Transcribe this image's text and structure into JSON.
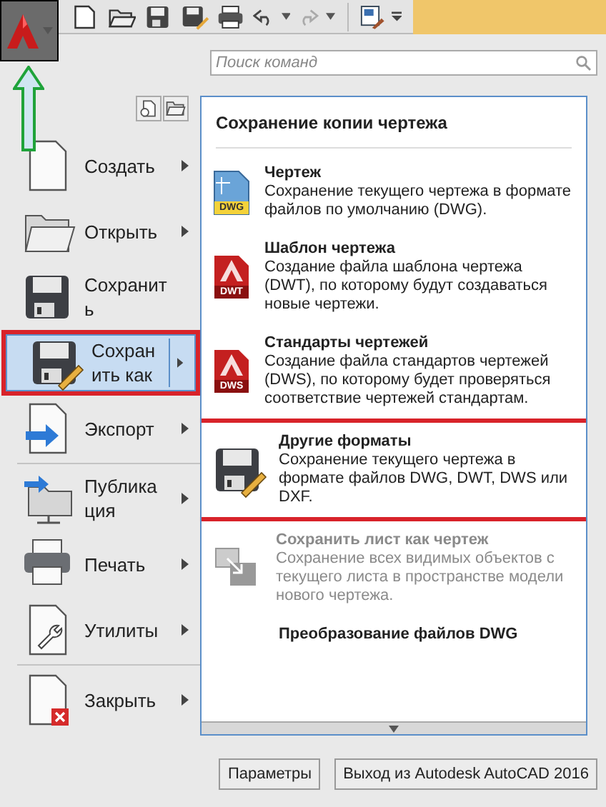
{
  "search": {
    "placeholder": "Поиск команд"
  },
  "menu": [
    {
      "label": "Создать",
      "submenu": true,
      "selected": false,
      "highlighted": false,
      "separator_after": false
    },
    {
      "label": "Открыть",
      "submenu": true,
      "selected": false,
      "highlighted": false,
      "separator_after": false
    },
    {
      "label": "Сохранить",
      "submenu": false,
      "selected": false,
      "highlighted": false,
      "separator_after": false
    },
    {
      "label": "Сохранить как",
      "submenu": true,
      "selected": true,
      "highlighted": true,
      "separator_after": false
    },
    {
      "label": "Экспорт",
      "submenu": true,
      "selected": false,
      "highlighted": false,
      "separator_after": true
    },
    {
      "label": "Публикация",
      "submenu": true,
      "selected": false,
      "highlighted": false,
      "separator_after": false
    },
    {
      "label": "Печать",
      "submenu": true,
      "selected": false,
      "highlighted": false,
      "separator_after": false
    },
    {
      "label": "Утилиты",
      "submenu": true,
      "selected": false,
      "highlighted": false,
      "separator_after": true
    },
    {
      "label": "Закрыть",
      "submenu": true,
      "selected": false,
      "highlighted": false,
      "separator_after": false
    }
  ],
  "panel": {
    "title": "Сохранение копии чертежа",
    "items": [
      {
        "title": "Чертеж",
        "description": "Сохранение текущего чертежа в формате файлов по умолчанию (DWG).",
        "disabled": false,
        "highlighted": false,
        "badge": "DWG"
      },
      {
        "title": "Шаблон чертежа",
        "description": "Создание файла шаблона чертежа (DWT), по которому будут создаваться новые чертежи.",
        "disabled": false,
        "highlighted": false,
        "badge": "DWT"
      },
      {
        "title": "Стандарты чертежей",
        "description": "Создание файла стандартов чертежей (DWS), по которому будет проверяться соответствие чертежей стандартам.",
        "disabled": false,
        "highlighted": false,
        "badge": "DWS"
      },
      {
        "title": "Другие форматы",
        "description": "Сохранение текущего чертежа в формате файлов DWG, DWT, DWS или DXF.",
        "disabled": false,
        "highlighted": true
      },
      {
        "title": "Сохранить лист как чертеж",
        "description": "Сохранение всех видимых объектов с текущего листа в пространстве модели нового чертежа.",
        "disabled": true,
        "highlighted": false
      },
      {
        "title": "Преобразование файлов DWG",
        "disabled": false,
        "highlighted": false
      }
    ]
  },
  "buttons": [
    "Параметры",
    "Выход из Autodesk AutoCAD 2016"
  ]
}
